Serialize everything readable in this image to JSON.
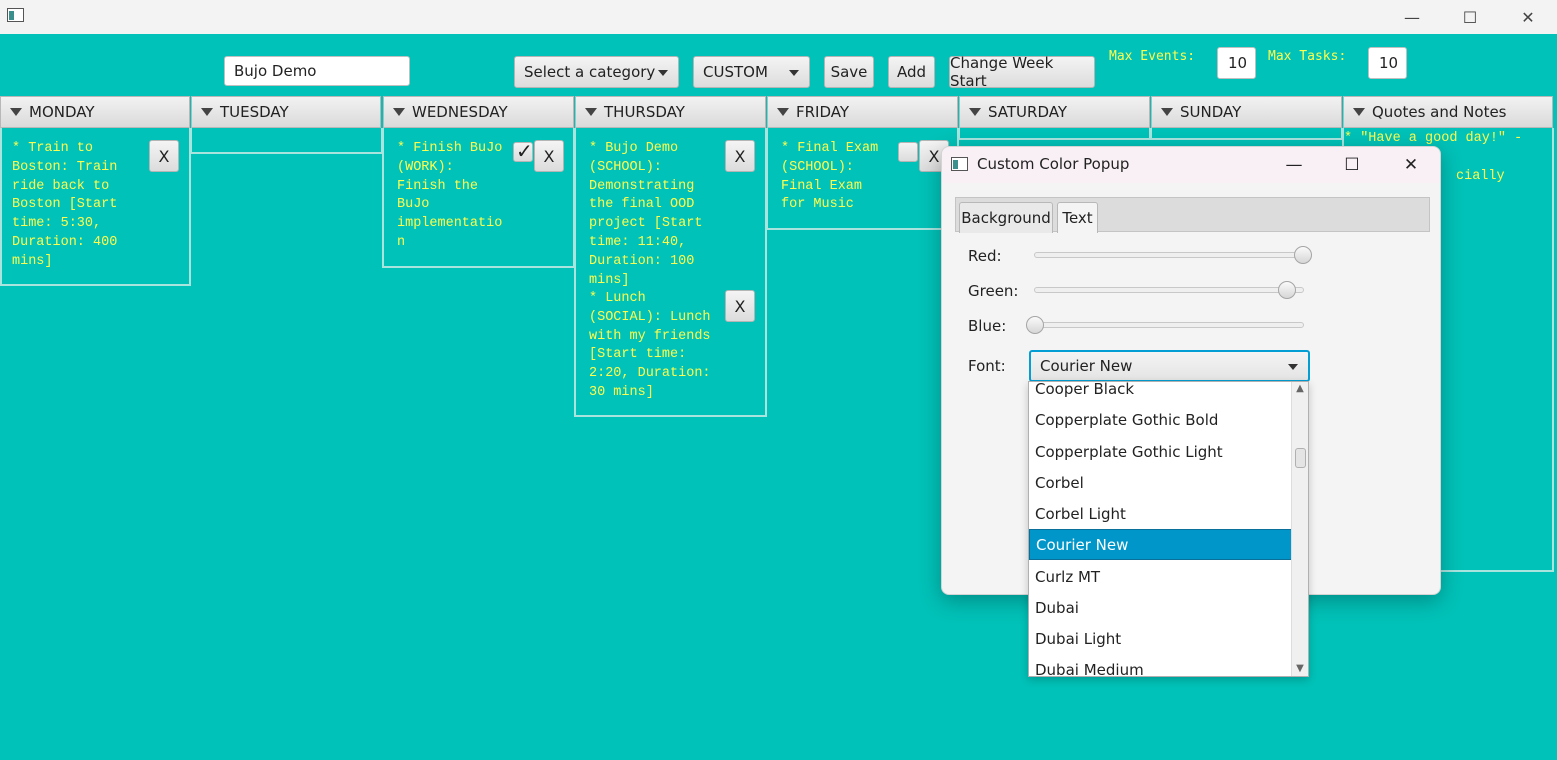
{
  "window": {
    "minimize_glyph": "—",
    "maximize_glyph": "☐",
    "close_glyph": "✕"
  },
  "toolbar": {
    "journal_name": "Bujo Demo",
    "category_select": "Select a category",
    "theme_select": "CUSTOM",
    "save_label": "Save",
    "add_label": "Add",
    "week_start_label": "Change Week Start",
    "max_events_label": "Max Events:",
    "max_events_value": "10",
    "max_tasks_label": "Max Tasks:",
    "max_tasks_value": "10"
  },
  "days": {
    "monday": {
      "label": "MONDAY",
      "entry0": "* Train to\nBoston: Train\nride back to\nBoston [Start\ntime: 5:30,\nDuration: 400\nmins]"
    },
    "tuesday": {
      "label": "TUESDAY"
    },
    "wednesday": {
      "label": "WEDNESDAY",
      "entry0": "* Finish BuJo\n(WORK):\nFinish the\nBuJo\nimplementatio\nn"
    },
    "thursday": {
      "label": "THURSDAY",
      "entry0": "* Bujo Demo\n(SCHOOL):\nDemonstrating\nthe final OOD\nproject [Start\ntime: 11:40,\nDuration: 100\nmins]",
      "entry1": "* Lunch\n(SOCIAL): Lunch\nwith my friends\n[Start time:\n2:20, Duration:\n30 mins]"
    },
    "friday": {
      "label": "FRIDAY",
      "entry0": "* Final Exam\n(SCHOOL):\nFinal Exam\nfor Music"
    },
    "saturday": {
      "label": "SATURDAY"
    },
    "sunday": {
      "label": "SUNDAY"
    },
    "notes": {
      "label": "Quotes and Notes",
      "line0_visible": "* \"Have a good day!\" -",
      "line1_visible": "cially"
    }
  },
  "delete_label": "X",
  "check_glyph": "✓",
  "popup": {
    "title": "Custom Color Popup",
    "tabs": [
      "Background",
      "Text"
    ],
    "active_tab": "Text",
    "red_label": "Red:",
    "green_label": "Green:",
    "blue_label": "Blue:",
    "font_label": "Font:",
    "red_value_fraction": 1.0,
    "green_value_fraction": 0.94,
    "blue_value_fraction": 0.0,
    "font_selected": "Courier New",
    "font_options": [
      "Cooper Black",
      "Copperplate Gothic Bold",
      "Copperplate Gothic Light",
      "Corbel",
      "Corbel Light",
      "Courier New",
      "Curlz MT",
      "Dubai",
      "Dubai Light",
      "Dubai Medium"
    ]
  },
  "colors": {
    "background": "#00c2b8",
    "entry_text": "#ffff4d",
    "selection": "#0096c9"
  }
}
